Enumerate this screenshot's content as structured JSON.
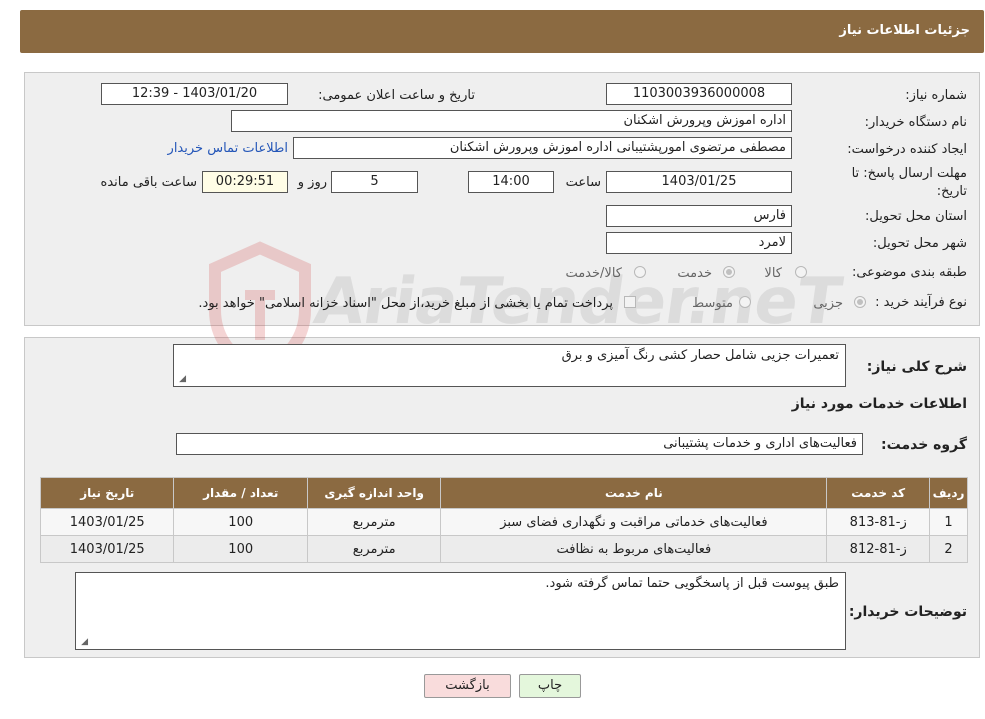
{
  "header": {
    "title": "جزئیات اطلاعات نیاز"
  },
  "form": {
    "need_number_label": "شماره نیاز:",
    "need_number": "1103003936000008",
    "announce_label": "تاریخ و ساعت اعلان عمومی:",
    "announce_value": "1403/01/20 - 12:39",
    "buyer_org_label": "نام دستگاه خریدار:",
    "buyer_org": "اداره اموزش وپرورش اشکنان",
    "creator_label": "ایجاد کننده درخواست:",
    "creator": "مصطفی مرتضوی امورپشتیبانی اداره اموزش وپرورش اشکنان",
    "contact_link": "اطلاعات تماس خریدار",
    "deadline_label_1": "مهلت ارسال پاسخ: تا",
    "deadline_label_2": "تاریخ:",
    "deadline_date": "1403/01/25",
    "hour_label": "ساعت",
    "deadline_time": "14:00",
    "days_value": "5",
    "days_label": "روز و",
    "remaining_time": "00:29:51",
    "remaining_label": "ساعت باقی مانده",
    "province_label": "استان محل تحویل:",
    "province": "فارس",
    "city_label": "شهر محل تحویل:",
    "city": "لامرد",
    "category_label": "طبقه بندی موضوعی:",
    "category_options": [
      "کالا",
      "خدمت",
      "کالا/خدمت"
    ],
    "category_selected": "خدمت",
    "process_label": "نوع فرآیند خرید :",
    "process_options": [
      "جزیی",
      "متوسط"
    ],
    "process_note": "پرداخت تمام یا بخشی از مبلغ خرید،از محل \"اسناد خزانه اسلامی\" خواهد بود."
  },
  "watermark": {
    "text": "AriaTender.neT"
  },
  "details": {
    "summary_label": "شرح کلی نیاز:",
    "summary": "تعمیرات جزیی شامل حصار کشی رنگ آمیزی و برق",
    "services_title": "اطلاعات خدمات مورد نیاز",
    "service_group_label": "گروه خدمت:",
    "service_group": "فعالیت‌های اداری و خدمات پشتیبانی",
    "table": {
      "headers": [
        "ردیف",
        "کد خدمت",
        "نام خدمت",
        "واحد اندازه گیری",
        "تعداد / مقدار",
        "تاریخ نیاز"
      ],
      "rows": [
        [
          "1",
          "ز-81-813",
          "فعالیت‌های خدماتی مراقبت و نگهداری فضای سبز",
          "مترمربع",
          "100",
          "1403/01/25"
        ],
        [
          "2",
          "ز-81-812",
          "فعالیت‌های مربوط به نظافت",
          "مترمربع",
          "100",
          "1403/01/25"
        ]
      ]
    },
    "buyer_notes_label": "توضیحات خریدار:",
    "buyer_notes": "طبق پیوست قبل از پاسخگویی حتما تماس گرفته شود."
  },
  "buttons": {
    "print": "چاپ",
    "back": "بازگشت"
  },
  "colors": {
    "header_bg": "#8b6a41",
    "panel_bg": "#efefef",
    "link": "#2456b8"
  }
}
